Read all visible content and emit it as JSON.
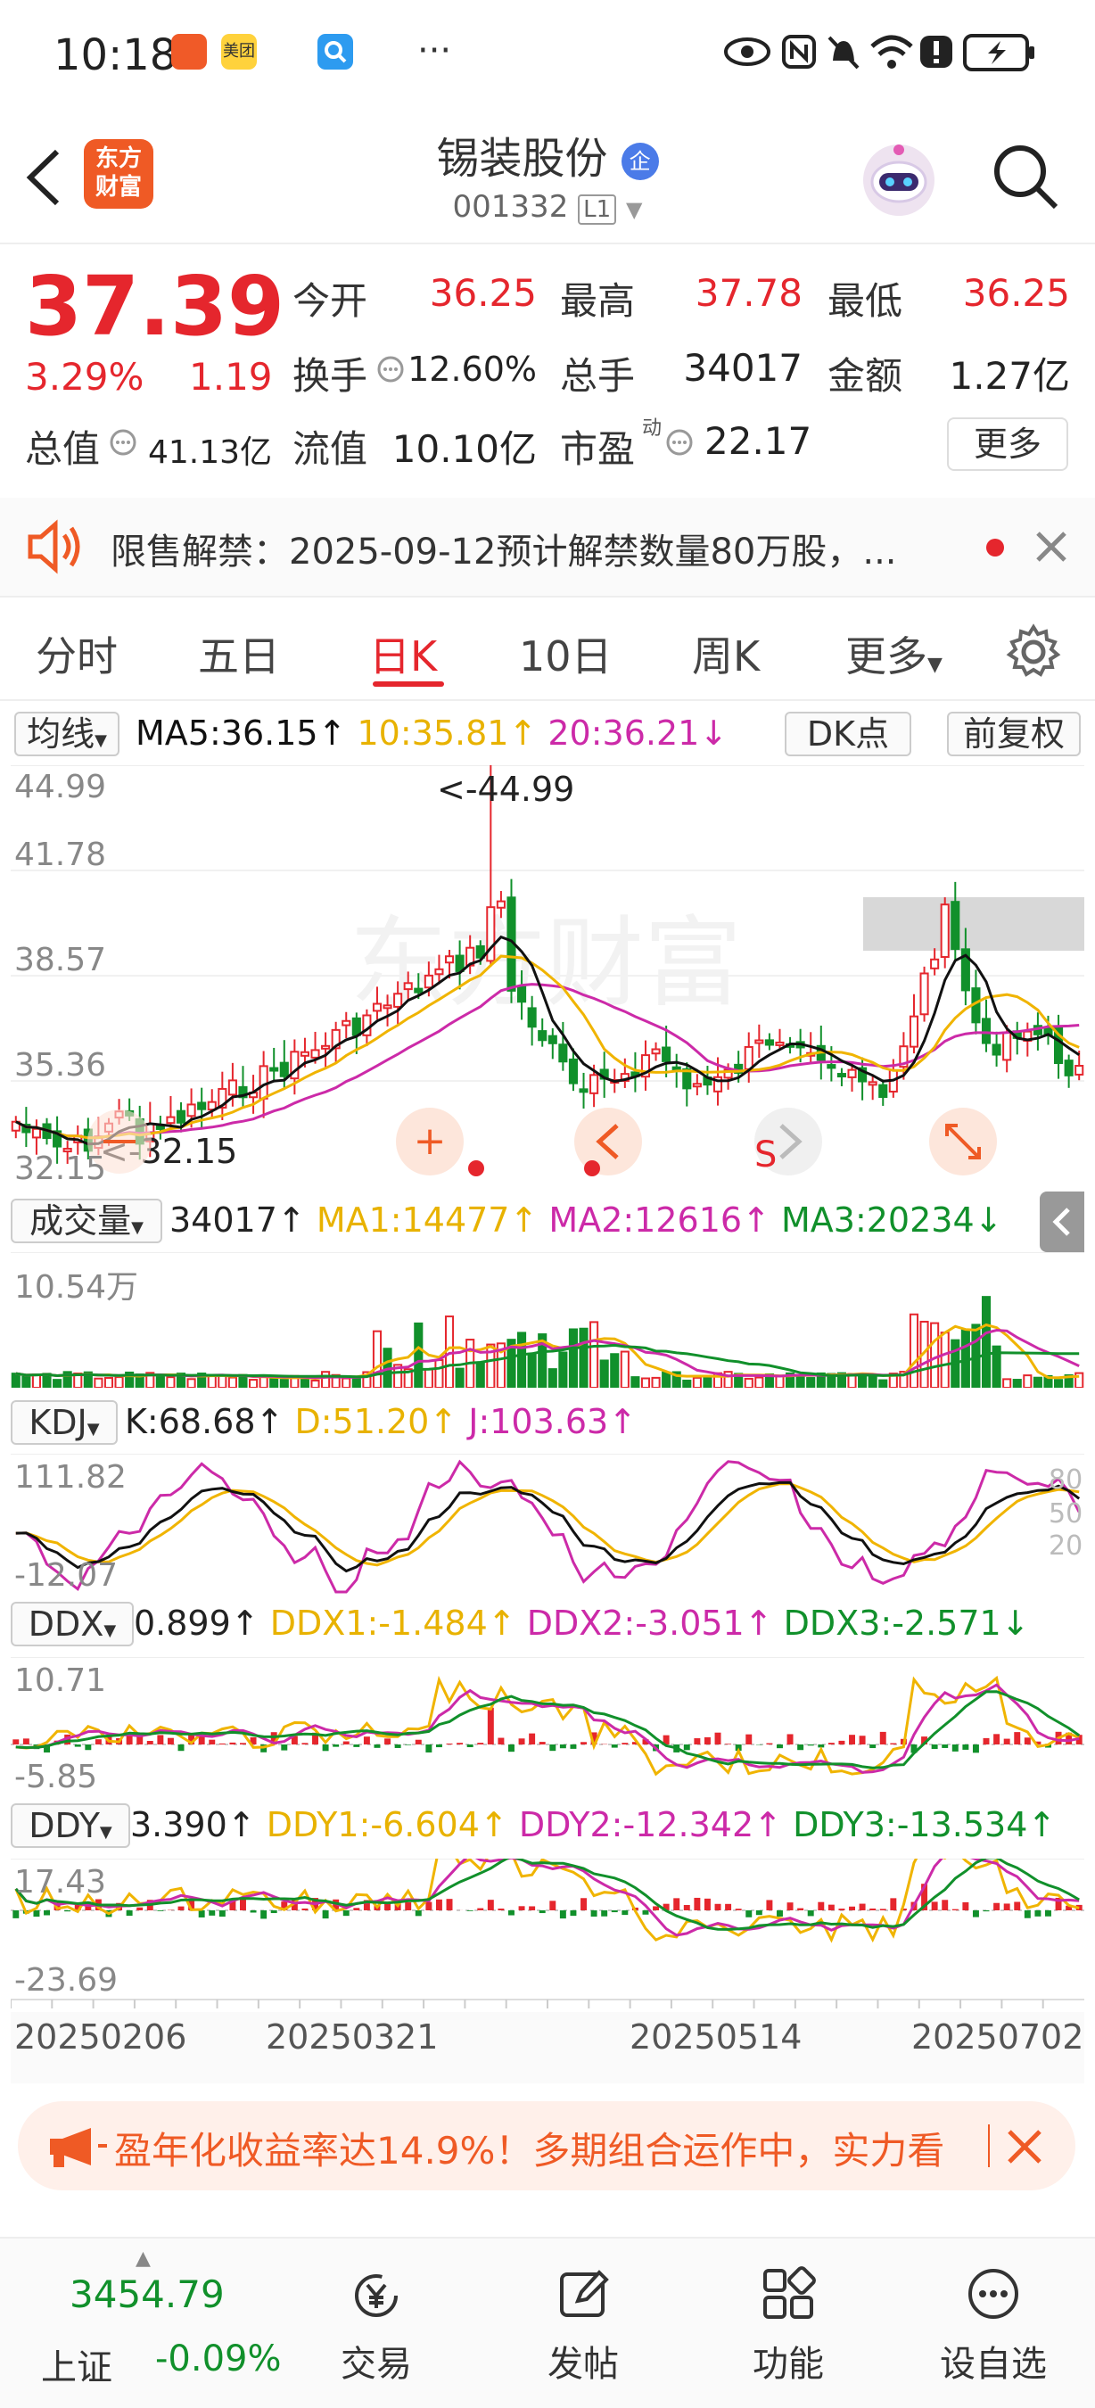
{
  "status_bar": {
    "time": "10:18",
    "app_icons": [
      "app-icon-red",
      "meituan-icon",
      "search-app-icon"
    ],
    "more": "···",
    "status_icons": [
      "eye-icon",
      "nfc-icon",
      "mute-icon",
      "wifi-icon",
      "alert-icon",
      "battery-charging-icon"
    ]
  },
  "header": {
    "stock_name": "锡装股份",
    "badge": "企",
    "code": "001332",
    "level": "L1",
    "logo_line1": "东方",
    "logo_line2": "财富"
  },
  "quote": {
    "price": "37.39",
    "change_pct": "3.29%",
    "change": "1.19",
    "fields": [
      {
        "label": "今开",
        "value": "36.25",
        "color": "#e5262d"
      },
      {
        "label": "最高",
        "value": "37.78",
        "color": "#e5262d"
      },
      {
        "label": "最低",
        "value": "36.25",
        "color": "#e5262d"
      },
      {
        "label": "换手",
        "value": "12.60%",
        "color": "#222222"
      },
      {
        "label": "总手",
        "value": "34017",
        "color": "#222222"
      },
      {
        "label": "金额",
        "value": "1.27亿",
        "color": "#222222"
      },
      {
        "label": "流值",
        "value": "10.10亿",
        "color": "#222222"
      },
      {
        "label": "市盈",
        "value": "22.17",
        "color": "#222222"
      }
    ],
    "total_value_label": "总值",
    "total_value": "41.13亿",
    "pe_superscript": "动",
    "more_label": "更多"
  },
  "notice": {
    "text": "限售解禁：2025-09-12预计解禁数量80万股，..."
  },
  "tabs": [
    "分时",
    "五日",
    "日K",
    "10日",
    "周K",
    "更多"
  ],
  "active_tab": "日K",
  "ma_row": {
    "selector": "均线",
    "ma5": "MA5:36.15↑",
    "ma10": "10:35.81↑",
    "ma20": "20:36.21↓",
    "dk": "DK点",
    "adjust": "前复权"
  },
  "kline": {
    "y_labels": [
      "44.99",
      "41.78",
      "38.57",
      "35.36",
      "32.15"
    ],
    "high_annotation": "<-44.99",
    "low_annotation": "<-32.15",
    "signal_label": "S",
    "watermark": "东方财富"
  },
  "volume": {
    "selector": "成交量",
    "value": "34017↑",
    "ma1": "MA1:14477↑",
    "ma2": "MA2:12616↑",
    "ma3": "MA3:20234↓",
    "y_label": "10.54万"
  },
  "kdj": {
    "selector": "KDJ",
    "k": "K:68.68↑",
    "d": "D:51.20↑",
    "j": "J:103.63↑",
    "y_top": "111.82",
    "y_bottom": "-12.07",
    "ref_80": "80",
    "ref_50": "50",
    "ref_20": "20"
  },
  "ddx": {
    "selector": "DDX",
    "value": "0.899↑",
    "ddx1": "DDX1:-1.484↑",
    "ddx2": "DDX2:-3.051↑",
    "ddx3": "DDX3:-2.571↓",
    "y_top": "10.71",
    "y_bottom": "-5.85"
  },
  "ddy": {
    "selector": "DDY",
    "value": "3.390↑",
    "ddy1": "DDY1:-6.604↑",
    "ddy2": "DDY2:-12.342↑",
    "ddy3": "DDY3:-13.534↑",
    "y_top": "17.43",
    "y_bottom": "-23.69"
  },
  "x_dates": [
    "20250206",
    "20250321",
    "20250514",
    "20250702"
  ],
  "banner": {
    "text": "盈年化收益率达14.9%！多期组合运作中，实力看"
  },
  "bottom_nav": {
    "index_value": "3454.79",
    "index_name": "上证",
    "index_change": "-0.09%",
    "items": [
      "交易",
      "发帖",
      "功能",
      "设自选"
    ]
  },
  "colors": {
    "up": "#e5262d",
    "down": "#11902b",
    "ma5": "#111111",
    "ma10": "#f0b400",
    "ma20": "#cc2aa8",
    "accent": "#ef5a25"
  }
}
